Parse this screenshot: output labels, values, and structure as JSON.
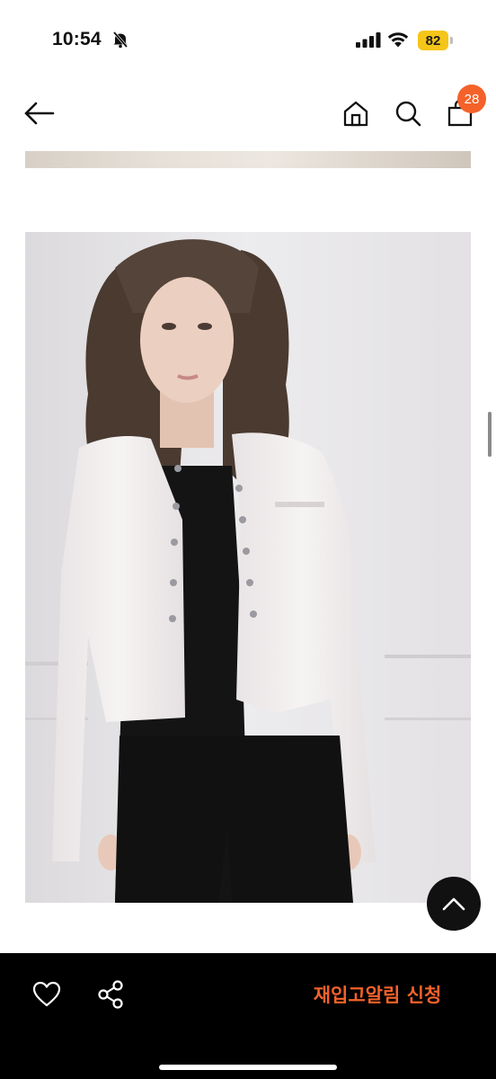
{
  "status_bar": {
    "time": "10:54",
    "battery": "82",
    "battery_color": "#f5c518",
    "icons": [
      "bell-slash-icon",
      "signal-icon",
      "wifi-icon",
      "battery-icon"
    ]
  },
  "nav": {
    "back_icon": "arrow-left-icon",
    "home_icon": "home-icon",
    "search_icon": "search-icon",
    "cart_icon": "shopping-bag-icon",
    "cart_count": "28",
    "badge_color": "#f4622a"
  },
  "product_image": {
    "icon": "product-photo"
  },
  "scroll_top": {
    "icon": "chevron-up-icon"
  },
  "bottom_bar": {
    "wishlist_icon": "heart-icon",
    "share_icon": "share-icon",
    "restock_label": "재입고알림 신청",
    "accent": "#f4622a",
    "background": "#000000"
  }
}
